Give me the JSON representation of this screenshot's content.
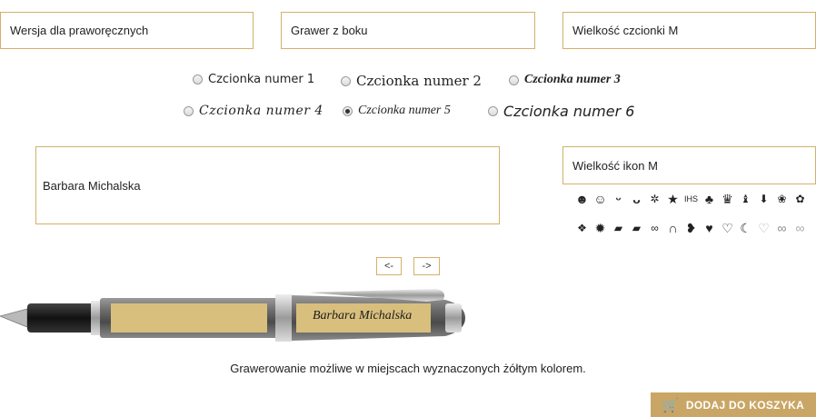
{
  "options": {
    "hand_version": "Wersja dla praworęcznych",
    "engraving_side": "Grawer z boku",
    "font_size": "Wielkość czcionki M",
    "icon_size": "Wielkość ikon M"
  },
  "fonts": {
    "items": [
      "Czcionka numer 1",
      "Czcionka numer 2",
      "Czcionka numer 3",
      "Czcionka numer 4",
      "Czcionka numer 5",
      "Czcionka numer 6"
    ],
    "selected": "Czcionka numer 5"
  },
  "engraving": {
    "text": "Barbara Michalska",
    "preview_text": "Barbara Michalska"
  },
  "icons": {
    "row1": [
      "smiley-icon",
      "smiley-outline-icon",
      "grin-icon",
      "big-grin-icon",
      "swirl-icon",
      "star-icon",
      "ihs-icon",
      "clover-icon",
      "crown-icon",
      "cat-icon",
      "tie-icon",
      "rose-icon",
      "rose-bloom-icon"
    ],
    "row2": [
      "paw-icon",
      "sun-icon",
      "graduation-cap-icon",
      "graduation-cap-2-icon",
      "rings-icon",
      "horseshoe-icon",
      "heart-split-icon",
      "heart-icon",
      "heart-outline-icon",
      "moon-icon",
      "heart-faint-icon",
      "infinity-icon",
      "infinity-2-icon"
    ],
    "ihs_label": "IHS"
  },
  "nav": {
    "prev": "<-",
    "next": "->"
  },
  "note": "Grawerowanie możliwe w miejscach wyznaczonych żółtym kolorem.",
  "cart": {
    "label": "DODAJ DO KOSZYKA"
  },
  "colors": {
    "accent": "#c9a665",
    "border": "#d4b06a",
    "engrave_area": "#d8bf7e"
  }
}
